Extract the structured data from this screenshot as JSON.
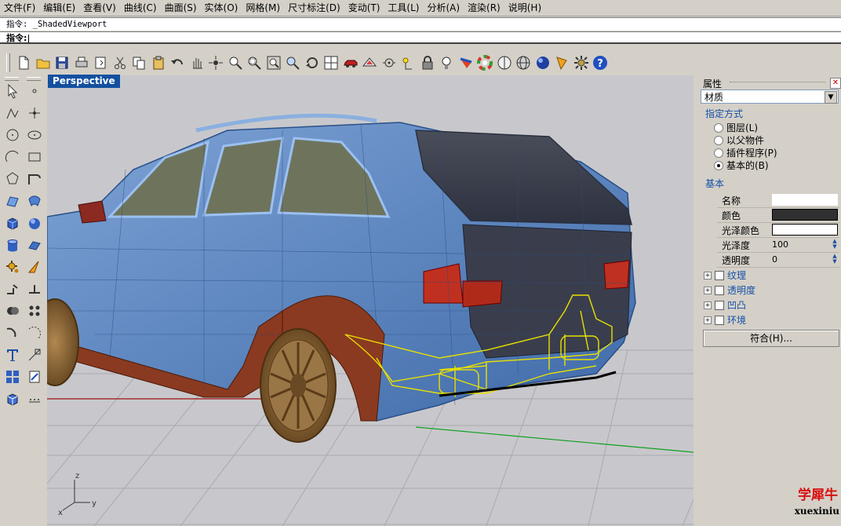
{
  "menu": [
    "文件(F)",
    "编辑(E)",
    "查看(V)",
    "曲线(C)",
    "曲面(S)",
    "实体(O)",
    "网格(M)",
    "尺寸标注(D)",
    "变动(T)",
    "工具(L)",
    "分析(A)",
    "渲染(R)",
    "说明(H)"
  ],
  "command": {
    "history": "指令: _ShadedViewport",
    "prompt": "指令:"
  },
  "viewport": {
    "label": "Perspective",
    "axes": {
      "x": "x",
      "y": "y",
      "z": "z"
    }
  },
  "toolbar_icons": [
    "new-file",
    "open-file",
    "save-file",
    "print",
    "page-setup",
    "cut",
    "copy",
    "paste",
    "undo",
    "pan-hand",
    "rotate-view",
    "zoom-dynamic",
    "zoom-window",
    "zoom-extents",
    "zoom-selected",
    "rotate-camera",
    "four-viewports",
    "car-object",
    "render-preview",
    "snap",
    "point-light",
    "lock",
    "light-bulb",
    "material-editor",
    "color-wheel",
    "wireframe-sphere",
    "mesh-sphere",
    "render-sphere",
    "spotlight",
    "settings-gear",
    "help"
  ],
  "left_toolbar_icons": [
    "select-arrow",
    "point",
    "polyline",
    "point-cloud",
    "circle",
    "ellipse",
    "arc",
    "rectangle",
    "polygon",
    "curve",
    "surface-from-edges",
    "loft-surface",
    "box-solid",
    "sphere-solid",
    "cylinder-solid",
    "extrude-surface",
    "gear-settings",
    "fillet",
    "move",
    "rotate",
    "boolean-union",
    "array",
    "dimension",
    "grow",
    "text-object",
    "curve-offset",
    "group-objects",
    "block-insert",
    "cube-3d",
    "divider-dots"
  ],
  "properties": {
    "title": "属性",
    "category": "材质",
    "assign_label": "指定方式",
    "assign_options": [
      {
        "label": "图层(L)",
        "selected": false
      },
      {
        "label": "以父物件",
        "selected": false
      },
      {
        "label": "插件程序(P)",
        "selected": false
      },
      {
        "label": "基本的(B)",
        "selected": true
      }
    ],
    "basic_label": "基本",
    "rows": [
      {
        "key": "名称",
        "value": ""
      },
      {
        "key": "颜色",
        "value": "",
        "color": "#303030"
      },
      {
        "key": "光泽颜色",
        "value": "",
        "color": "#ffffff"
      },
      {
        "key": "光泽度",
        "value": "100"
      },
      {
        "key": "透明度",
        "value": "0"
      }
    ],
    "sections": [
      "纹理",
      "透明度",
      "凹凸",
      "环境"
    ],
    "match_button": "符合(H)..."
  },
  "watermark": {
    "cn": "学犀牛",
    "en": "xuexiniu"
  },
  "colors": {
    "viewport_bg": "#c8c8cc",
    "car_body": "#5a86c0",
    "wheel": "#8b6a3c",
    "highlight": "#e8e000",
    "label_bg": "#1450a0"
  }
}
